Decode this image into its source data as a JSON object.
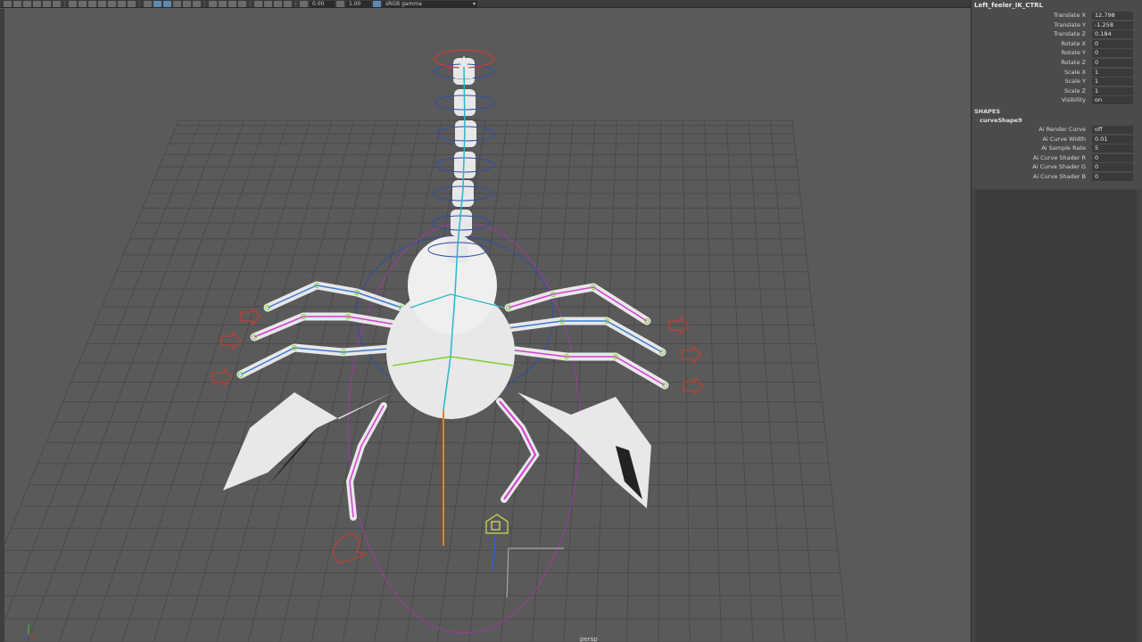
{
  "toolbar": {
    "field_exposure": "0.00",
    "field_gamma": "1.00",
    "color_space": "sRGB gamma"
  },
  "viewport": {
    "camera_label": "persp"
  },
  "channel_box": {
    "node_name": "Left_feeler_IK_CTRL",
    "transform_attrs": [
      {
        "label": "Translate X",
        "value": "12.798"
      },
      {
        "label": "Translate Y",
        "value": "-1.258"
      },
      {
        "label": "Translate Z",
        "value": "0.184"
      },
      {
        "label": "Rotate X",
        "value": "0"
      },
      {
        "label": "Rotate Y",
        "value": "0"
      },
      {
        "label": "Rotate Z",
        "value": "0"
      },
      {
        "label": "Scale X",
        "value": "1"
      },
      {
        "label": "Scale Y",
        "value": "1"
      },
      {
        "label": "Scale Z",
        "value": "1"
      },
      {
        "label": "Visibility",
        "value": "on"
      }
    ],
    "shapes_header": "SHAPES",
    "shape_name": "curveShape9",
    "shape_attrs": [
      {
        "label": "Ai Render Curve",
        "value": "off"
      },
      {
        "label": "Ai Curve Width",
        "value": "0.01"
      },
      {
        "label": "Ai Sample Rate",
        "value": "5"
      },
      {
        "label": "Ai Curve Shader R",
        "value": "0"
      },
      {
        "label": "Ai Curve Shader G",
        "value": "0"
      },
      {
        "label": "Ai Curve Shader B",
        "value": "0"
      }
    ]
  },
  "colors": {
    "viewport_bg": "#5a5a5a",
    "grid_line": "#4a4a4a",
    "mesh": "#e8e8e8",
    "ik_ctrl": "#d23a2a",
    "spine_joint": "#25b8c9",
    "leg_joint_green": "#7ccf2a",
    "leg_joint_magenta": "#d63cd6",
    "tail_ring": "#2b4fa8",
    "root_line": "#d9852b"
  }
}
